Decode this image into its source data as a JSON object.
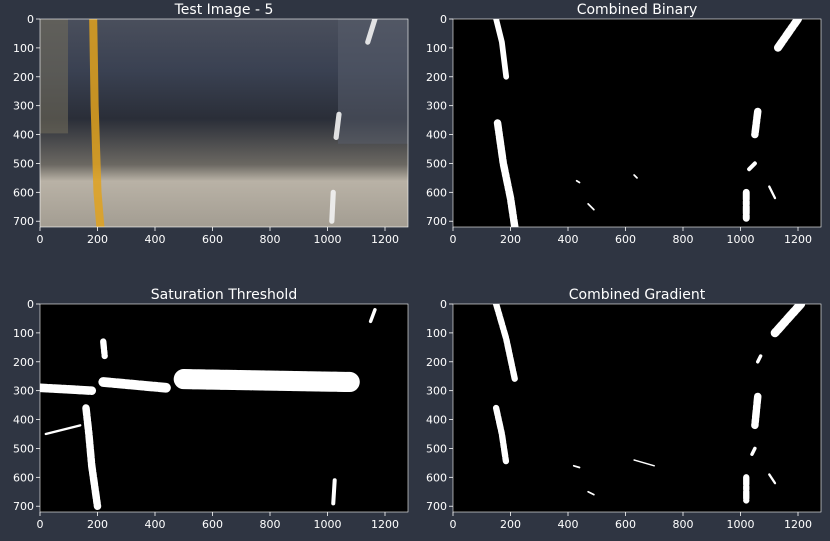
{
  "colors": {
    "figure_bg": "#2f3542",
    "axes_bg": "#000000",
    "foreground": "#ffffff",
    "tick_text": "#ffffff"
  },
  "chart_data": [
    {
      "type": "image",
      "title": "Test Image - 5",
      "image_kind": "road-photo-warped",
      "xlim": [
        0,
        1280
      ],
      "ylim": [
        720,
        0
      ],
      "xticks": [
        0,
        200,
        400,
        600,
        800,
        1000,
        1200
      ],
      "yticks": [
        0,
        100,
        200,
        300,
        400,
        500,
        600,
        700
      ],
      "colors": {
        "sky": "#3a4152",
        "asphalt": "#2a2e38",
        "road_light": "#b9b2a6",
        "yellow_line": "#e0a21e",
        "white_line": "#f2f2f2"
      },
      "features": [
        {
          "name": "yellow-lane-line",
          "color": "yellow",
          "polyline": [
            [
              185,
              0
            ],
            [
              190,
              300
            ],
            [
              200,
              600
            ],
            [
              210,
              720
            ]
          ],
          "width": 28
        },
        {
          "name": "white-lane-dash-top",
          "color": "white",
          "polyline": [
            [
              1165,
              0
            ],
            [
              1140,
              80
            ]
          ],
          "width": 18
        },
        {
          "name": "white-lane-dash-mid",
          "color": "white",
          "polyline": [
            [
              1040,
              330
            ],
            [
              1030,
              410
            ]
          ],
          "width": 18
        },
        {
          "name": "white-lane-dash-bottom",
          "color": "white",
          "polyline": [
            [
              1020,
              600
            ],
            [
              1015,
              700
            ]
          ],
          "width": 18
        }
      ]
    },
    {
      "type": "image",
      "title": "Combined Binary",
      "image_kind": "binary-mask",
      "xlim": [
        0,
        1280
      ],
      "ylim": [
        720,
        0
      ],
      "xticks": [
        0,
        200,
        400,
        600,
        800,
        1000,
        1200
      ],
      "yticks": [
        0,
        100,
        200,
        300,
        400,
        500,
        600,
        700
      ],
      "features": [
        {
          "name": "left-lane-upper",
          "polyline": [
            [
              150,
              0
            ],
            [
              170,
              80
            ],
            [
              185,
              200
            ]
          ],
          "width": 20
        },
        {
          "name": "left-lane-lower",
          "polyline": [
            [
              155,
              360
            ],
            [
              175,
              500
            ],
            [
              200,
              620
            ],
            [
              215,
              720
            ]
          ],
          "width": 26
        },
        {
          "name": "right-lane-top",
          "polyline": [
            [
              1200,
              0
            ],
            [
              1130,
              100
            ]
          ],
          "width": 28
        },
        {
          "name": "right-lane-mid",
          "polyline": [
            [
              1060,
              320
            ],
            [
              1050,
              400
            ]
          ],
          "width": 26
        },
        {
          "name": "right-lane-small",
          "polyline": [
            [
              1050,
              500
            ],
            [
              1030,
              520
            ]
          ],
          "width": 14
        },
        {
          "name": "right-lane-bottom",
          "polyline": [
            [
              1020,
              600
            ],
            [
              1020,
              690
            ]
          ],
          "width": 24
        },
        {
          "name": "speckle-1",
          "polyline": [
            [
              430,
              560
            ],
            [
              440,
              566
            ]
          ],
          "width": 6
        },
        {
          "name": "speckle-2",
          "polyline": [
            [
              470,
              640
            ],
            [
              490,
              660
            ]
          ],
          "width": 6
        },
        {
          "name": "speckle-3",
          "polyline": [
            [
              630,
              540
            ],
            [
              640,
              550
            ]
          ],
          "width": 6
        },
        {
          "name": "speckle-4",
          "polyline": [
            [
              1100,
              580
            ],
            [
              1120,
              620
            ]
          ],
          "width": 8
        }
      ]
    },
    {
      "type": "image",
      "title": "Saturation Threshold",
      "image_kind": "binary-mask",
      "xlim": [
        0,
        1280
      ],
      "ylim": [
        720,
        0
      ],
      "xticks": [
        0,
        200,
        400,
        600,
        800,
        1000,
        1200
      ],
      "yticks": [
        0,
        100,
        200,
        300,
        400,
        500,
        600,
        700
      ],
      "features": [
        {
          "name": "left-lane",
          "polyline": [
            [
              160,
              360
            ],
            [
              170,
              450
            ],
            [
              180,
              560
            ],
            [
              200,
              700
            ]
          ],
          "width": 26
        },
        {
          "name": "left-blob-top",
          "polyline": [
            [
              220,
              130
            ],
            [
              225,
              180
            ]
          ],
          "width": 22
        },
        {
          "name": "left-band",
          "polyline": [
            [
              0,
              290
            ],
            [
              180,
              300
            ]
          ],
          "width": 30
        },
        {
          "name": "left-band-2",
          "polyline": [
            [
              220,
              270
            ],
            [
              440,
              290
            ]
          ],
          "width": 34
        },
        {
          "name": "center-band",
          "polyline": [
            [
              500,
              260
            ],
            [
              1080,
              270
            ]
          ],
          "width": 70
        },
        {
          "name": "right-lane-top",
          "polyline": [
            [
              1165,
              20
            ],
            [
              1150,
              60
            ]
          ],
          "width": 12
        },
        {
          "name": "right-lane-bottom",
          "polyline": [
            [
              1025,
              610
            ],
            [
              1020,
              690
            ]
          ],
          "width": 14
        },
        {
          "name": "left-scatter",
          "polyline": [
            [
              20,
              450
            ],
            [
              140,
              420
            ]
          ],
          "width": 8
        }
      ]
    },
    {
      "type": "image",
      "title": "Combined Gradient",
      "image_kind": "binary-mask",
      "xlim": [
        0,
        1280
      ],
      "ylim": [
        720,
        0
      ],
      "xticks": [
        0,
        200,
        400,
        600,
        800,
        1000,
        1200
      ],
      "yticks": [
        0,
        100,
        200,
        300,
        400,
        500,
        600,
        700
      ],
      "features": [
        {
          "name": "left-lane-upper",
          "polyline": [
            [
              150,
              0
            ],
            [
              185,
              120
            ],
            [
              215,
              260
            ]
          ],
          "width": 22
        },
        {
          "name": "left-lane-lower",
          "polyline": [
            [
              150,
              360
            ],
            [
              170,
              450
            ],
            [
              185,
              550
            ]
          ],
          "width": 22
        },
        {
          "name": "right-lane-top",
          "polyline": [
            [
              1210,
              0
            ],
            [
              1120,
              100
            ]
          ],
          "width": 30
        },
        {
          "name": "right-lane-small",
          "polyline": [
            [
              1070,
              180
            ],
            [
              1060,
              200
            ]
          ],
          "width": 12
        },
        {
          "name": "right-lane-mid",
          "polyline": [
            [
              1060,
              320
            ],
            [
              1050,
              420
            ]
          ],
          "width": 26
        },
        {
          "name": "right-lane-small-2",
          "polyline": [
            [
              1050,
              500
            ],
            [
              1040,
              520
            ]
          ],
          "width": 12
        },
        {
          "name": "right-lane-bottom",
          "polyline": [
            [
              1020,
              600
            ],
            [
              1020,
              680
            ]
          ],
          "width": 22
        },
        {
          "name": "speckle-1",
          "polyline": [
            [
              420,
              560
            ],
            [
              440,
              566
            ]
          ],
          "width": 6
        },
        {
          "name": "speckle-2",
          "polyline": [
            [
              470,
              650
            ],
            [
              490,
              660
            ]
          ],
          "width": 6
        },
        {
          "name": "speckle-3",
          "polyline": [
            [
              630,
              540
            ],
            [
              700,
              560
            ]
          ],
          "width": 5
        },
        {
          "name": "speckle-4",
          "polyline": [
            [
              1100,
              590
            ],
            [
              1120,
              620
            ]
          ],
          "width": 8
        }
      ]
    }
  ]
}
